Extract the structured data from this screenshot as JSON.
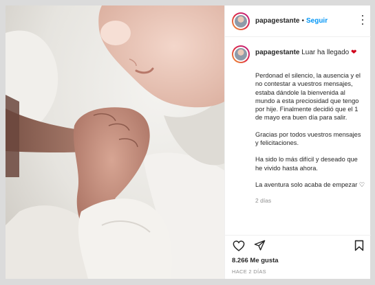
{
  "post": {
    "username": "papagestante",
    "separator": "•",
    "follow_label": "Seguir",
    "caption": {
      "username": "papagestante",
      "headline": "Luar ha llegado",
      "headline_emoji": "❤",
      "paragraphs": [
        "Perdonad el silencio, la ausencia y el no contestar a vuestros mensajes, estaba dándole la bienvenida al mundo a esta preciosidad que tengo por hije. Finalmente decidió que el 1 de mayo era buen día para salir.",
        "Gracias por todos vuestros mensajes y felicitaciones.",
        "Ha sido lo más difícil y deseado que he vivido hasta ahora.",
        "La aventura solo acaba de empezar ♡"
      ],
      "age": "2 días"
    },
    "likes": "8.266 Me gusta",
    "date": "HACE 2 DÍAS"
  },
  "icons": {
    "avatar": "profile-avatar",
    "more": "more-options-icon",
    "like": "heart-icon",
    "share": "paper-plane-icon",
    "save": "bookmark-icon"
  },
  "colors": {
    "link_blue": "#0095f6",
    "muted_gray": "#8e8e8e",
    "text": "#262626",
    "heart_red": "#d0021b"
  }
}
